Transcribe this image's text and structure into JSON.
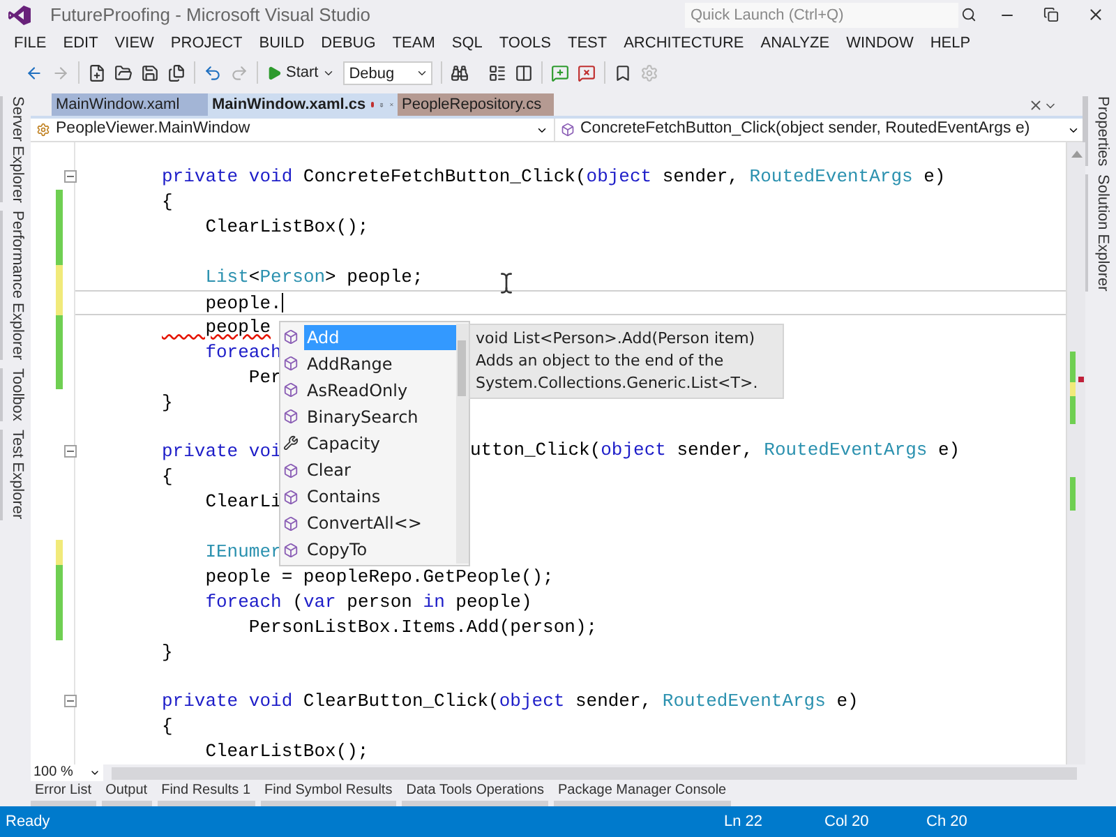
{
  "window": {
    "title": "FutureProofing - Microsoft Visual Studio"
  },
  "quick_launch": {
    "placeholder": "Quick Launch (Ctrl+Q)"
  },
  "menu": [
    "FILE",
    "EDIT",
    "VIEW",
    "PROJECT",
    "BUILD",
    "DEBUG",
    "TEAM",
    "SQL",
    "TOOLS",
    "TEST",
    "ARCHITECTURE",
    "ANALYZE",
    "WINDOW",
    "HELP"
  ],
  "toolbar": {
    "start": "Start",
    "configuration": "Debug"
  },
  "side_tabs_left": [
    "Server Explorer",
    "Performance Explorer",
    "Toolbox",
    "Test Explorer"
  ],
  "side_tabs_right": [
    "Properties",
    "Solution Explorer"
  ],
  "document_tabs": [
    {
      "label": "MainWindow.xaml",
      "selected": false,
      "modified": false,
      "color": "#a3b5d6"
    },
    {
      "label": "MainWindow.xaml.cs",
      "selected": true,
      "modified": true,
      "color": "#cddcf0"
    },
    {
      "label": "PeopleRepository.cs",
      "selected": false,
      "modified": false,
      "color": "#b59a92"
    }
  ],
  "navigation": {
    "type_scope": "PeopleViewer.MainWindow",
    "member": "ConcreteFetchButton_Click(object sender, RoutedEventArgs e)"
  },
  "code_lines": [
    {
      "fold": true,
      "current": false,
      "tokens": [
        {
          "kind": "keyword",
          "text": "private void"
        },
        {
          "kind": "plain",
          "text": " ConcreteFetchButton_Click("
        },
        {
          "kind": "keyword",
          "text": "object"
        },
        {
          "kind": "plain",
          "text": " sender, "
        },
        {
          "kind": "type",
          "text": "RoutedEventArgs"
        },
        {
          "kind": "plain",
          "text": " e)"
        }
      ]
    },
    {
      "fold": false,
      "current": false,
      "color": "#6fcf52",
      "tokens": [
        {
          "kind": "plain",
          "text": "{"
        }
      ]
    },
    {
      "fold": false,
      "current": false,
      "color": "#6fcf52",
      "tokens": [
        {
          "kind": "plain",
          "text": "    ClearListBox();"
        }
      ]
    },
    {
      "fold": false,
      "current": false,
      "color": "#6fcf52"
    },
    {
      "fold": false,
      "current": false,
      "color": "#f1ea7a",
      "tokens": [
        {
          "kind": "type",
          "text": "    List"
        },
        {
          "kind": "plain",
          "text": "<"
        },
        {
          "kind": "type",
          "text": "Person"
        },
        {
          "kind": "plain",
          "text": "> people;"
        }
      ]
    },
    {
      "fold": false,
      "current": true,
      "color": "#f1ea7a",
      "tokens": [
        {
          "kind": "plain",
          "text": "    people."
        }
      ]
    },
    {
      "fold": false,
      "current": false,
      "color": "#6fcf52",
      "tokens": [
        {
          "kind": "squiggle",
          "text": "    people"
        }
      ]
    },
    {
      "fold": false,
      "current": false,
      "color": "#6fcf52",
      "tokens": [
        {
          "kind": "keyword",
          "text": "    foreach"
        }
      ]
    },
    {
      "fold": false,
      "current": false,
      "color": "#6fcf52",
      "tokens": [
        {
          "kind": "plain",
          "text": "        Per"
        }
      ]
    },
    {
      "fold": false,
      "current": false,
      "tokens": [
        {
          "kind": "plain",
          "text": "}"
        }
      ]
    },
    {
      "fold": false,
      "current": false
    },
    {
      "fold": true,
      "current": false,
      "tokens": [
        {
          "kind": "keyword",
          "text": "private voi"
        }
      ],
      "tail": [
        {
          "kind": "plain",
          "text": "utton_Click("
        },
        {
          "kind": "keyword",
          "text": "object"
        },
        {
          "kind": "plain",
          "text": " sender, "
        },
        {
          "kind": "type",
          "text": "RoutedEventArgs"
        },
        {
          "kind": "plain",
          "text": " e)"
        }
      ]
    },
    {
      "fold": false,
      "current": false,
      "tokens": [
        {
          "kind": "plain",
          "text": "{"
        }
      ]
    },
    {
      "fold": false,
      "current": false,
      "tokens": [
        {
          "kind": "plain",
          "text": "    ClearLi"
        }
      ]
    },
    {
      "fold": false,
      "current": false
    },
    {
      "fold": false,
      "current": false,
      "color": "#f1ea7a",
      "tokens": [
        {
          "kind": "type",
          "text": "    IEnumer"
        }
      ]
    },
    {
      "fold": false,
      "current": false,
      "color": "#6fcf52",
      "tokens": [
        {
          "kind": "plain",
          "text": "    people = peopleRepo.GetPeople();"
        }
      ]
    },
    {
      "fold": false,
      "current": false,
      "color": "#6fcf52",
      "tokens": [
        {
          "kind": "keyword",
          "text": "    foreach"
        },
        {
          "kind": "plain",
          "text": " ("
        },
        {
          "kind": "keyword",
          "text": "var"
        },
        {
          "kind": "plain",
          "text": " person "
        },
        {
          "kind": "keyword",
          "text": "in"
        },
        {
          "kind": "plain",
          "text": " people)"
        }
      ]
    },
    {
      "fold": false,
      "current": false,
      "color": "#6fcf52",
      "tokens": [
        {
          "kind": "plain",
          "text": "        PersonListBox.Items.Add(person);"
        }
      ]
    },
    {
      "fold": false,
      "current": false,
      "tokens": [
        {
          "kind": "plain",
          "text": "}"
        }
      ]
    },
    {
      "fold": false,
      "current": false
    },
    {
      "fold": true,
      "current": false,
      "tokens": [
        {
          "kind": "keyword",
          "text": "private void"
        },
        {
          "kind": "plain",
          "text": " ClearButton_Click("
        },
        {
          "kind": "keyword",
          "text": "object"
        },
        {
          "kind": "plain",
          "text": " sender, "
        },
        {
          "kind": "type",
          "text": "RoutedEventArgs"
        },
        {
          "kind": "plain",
          "text": " e)"
        }
      ]
    },
    {
      "fold": false,
      "current": false,
      "tokens": [
        {
          "kind": "plain",
          "text": "{"
        }
      ]
    },
    {
      "fold": false,
      "current": false,
      "tokens": [
        {
          "kind": "plain",
          "text": "    ClearListBox();"
        }
      ]
    }
  ],
  "completion": {
    "items": [
      {
        "label": "Add",
        "kind": "method",
        "selected": true
      },
      {
        "label": "AddRange",
        "kind": "method",
        "selected": false
      },
      {
        "label": "AsReadOnly",
        "kind": "method",
        "selected": false
      },
      {
        "label": "BinarySearch",
        "kind": "method",
        "selected": false
      },
      {
        "label": "Capacity",
        "kind": "property",
        "selected": false
      },
      {
        "label": "Clear",
        "kind": "method",
        "selected": false
      },
      {
        "label": "Contains",
        "kind": "method",
        "selected": false
      },
      {
        "label": "ConvertAll<>",
        "kind": "method",
        "selected": false
      },
      {
        "label": "CopyTo",
        "kind": "method",
        "selected": false
      }
    ],
    "tooltip": {
      "signature": "void List<Person>.Add(Person item)",
      "description": "Adds an object to the end of the System.Collections.Generic.List<T>."
    }
  },
  "zoom": "100 %",
  "tool_tabs": [
    "Error List",
    "Output",
    "Find Results 1",
    "Find Symbol Results",
    "Data Tools Operations",
    "Package Manager Console"
  ],
  "status_bar": {
    "state": "Ready",
    "line": "Ln 22",
    "column": "Col 20",
    "char": "Ch 20"
  }
}
